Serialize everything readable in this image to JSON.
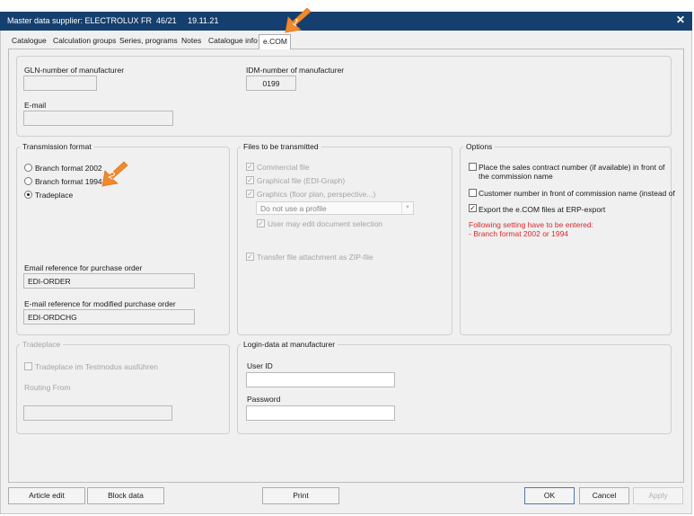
{
  "window": {
    "title": "Master data supplier: ELECTROLUX FR  46/21     19.11.21"
  },
  "tabs": [
    {
      "label": "Catalogue"
    },
    {
      "label": "Calculation groups"
    },
    {
      "label": "Series, programs"
    },
    {
      "label": "Notes"
    },
    {
      "label": "Catalogue info"
    },
    {
      "label": "e.COM",
      "active": true
    }
  ],
  "manufacturer": {
    "gln_label": "GLN-number of manufacturer",
    "gln_value": "",
    "idm_label": "IDM-number of manufacturer",
    "idm_value": "0199",
    "email_label": "E-mail",
    "email_value": ""
  },
  "transmission": {
    "title": "Transmission format",
    "options": [
      {
        "label": "Branch format 2002",
        "checked": false
      },
      {
        "label": "Branch format 1994",
        "checked": false
      },
      {
        "label": "Tradeplace",
        "checked": true
      }
    ],
    "email_ref_label": "Email reference for purchase order",
    "email_ref_value": "EDI-ORDER",
    "email_mod_label": "E-mail reference for modified purchase order",
    "email_mod_value": "EDI-ORDCHG"
  },
  "files": {
    "title": "Files to be transmitted",
    "commercial": "Commercial file",
    "graphical": "Graphical file (EDI-Graph)",
    "graphics": "Graphics (floor plan, perspective...)",
    "profile_value": "Do not use a profile",
    "user_edit": "User may edit document selection",
    "zip": "Transfer file attachment as ZIP-file"
  },
  "options": {
    "title": "Options",
    "place_contract": "Place the sales contract number (if available) in front of the commission name",
    "customer_number": "Customer number in front of commission name (instead of",
    "export_ecom": "Export the e.COM files at ERP-export",
    "warning_line1": "Following setting have to be entered:",
    "warning_line2": "- Branch format 2002 or 1994"
  },
  "tradeplace": {
    "title": "Tradeplace",
    "testmode": "Tradeplace im Testmodus ausführen",
    "routing_label": "Routing From",
    "routing_value": ""
  },
  "login": {
    "title": "Login-data at manufacturer",
    "user_label": "User ID",
    "user_value": "",
    "password_label": "Password",
    "password_value": ""
  },
  "buttons": {
    "article_edit": "Article edit",
    "block_data": "Block data",
    "print": "Print",
    "ok": "OK",
    "cancel": "Cancel",
    "apply": "Apply"
  },
  "markers": {
    "one": "1",
    "two": "2"
  },
  "colors": {
    "titlebar": "#153f6e",
    "marker": "#f08a2e",
    "warning": "#d62c2c"
  }
}
